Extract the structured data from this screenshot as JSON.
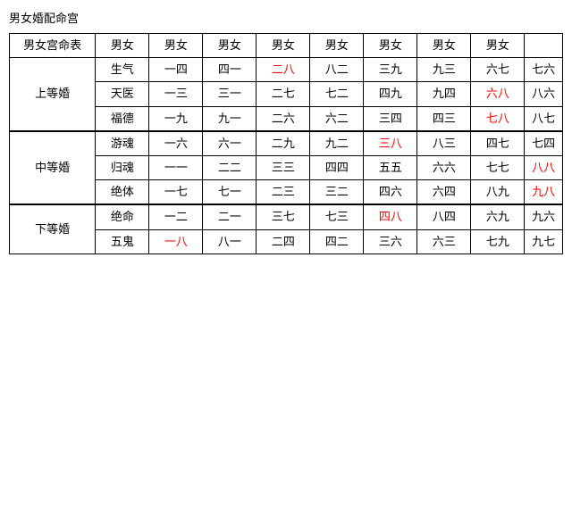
{
  "title": "男女婚配命宫",
  "table": {
    "header": {
      "col0": "男女宫命表",
      "cols": [
        "男女",
        "男女",
        "男女",
        "男女",
        "男女",
        "男女",
        "男女",
        "男女"
      ]
    },
    "sections": [
      {
        "grade": "上等婚",
        "rows": [
          {
            "category": "生气",
            "cells": [
              {
                "text": "一四",
                "red": false
              },
              {
                "text": "四一",
                "red": false
              },
              {
                "text": "二八",
                "red": true
              },
              {
                "text": "八二",
                "red": false
              },
              {
                "text": "三九",
                "red": false
              },
              {
                "text": "九三",
                "red": false
              },
              {
                "text": "六七",
                "red": false
              },
              {
                "text": "七六",
                "red": false
              }
            ]
          },
          {
            "category": "天医",
            "cells": [
              {
                "text": "一三",
                "red": false
              },
              {
                "text": "三一",
                "red": false
              },
              {
                "text": "二七",
                "red": false
              },
              {
                "text": "七二",
                "red": false
              },
              {
                "text": "四九",
                "red": false
              },
              {
                "text": "九四",
                "red": false
              },
              {
                "text": "六八",
                "red": true
              },
              {
                "text": "八六",
                "red": false
              }
            ]
          },
          {
            "category": "福德",
            "cells": [
              {
                "text": "一九",
                "red": false
              },
              {
                "text": "九一",
                "red": false
              },
              {
                "text": "二六",
                "red": false
              },
              {
                "text": "六二",
                "red": false
              },
              {
                "text": "三四",
                "red": false
              },
              {
                "text": "四三",
                "red": false
              },
              {
                "text": "七八",
                "red": true
              },
              {
                "text": "八七",
                "red": false
              }
            ]
          }
        ]
      },
      {
        "grade": "中等婚",
        "rows": [
          {
            "category": "游魂",
            "cells": [
              {
                "text": "一六",
                "red": false
              },
              {
                "text": "六一",
                "red": false
              },
              {
                "text": "二九",
                "red": false
              },
              {
                "text": "九二",
                "red": false
              },
              {
                "text": "三八",
                "red": true
              },
              {
                "text": "八三",
                "red": false
              },
              {
                "text": "四七",
                "red": false
              },
              {
                "text": "七四",
                "red": false
              }
            ]
          },
          {
            "category": "归魂",
            "cells": [
              {
                "text": "一一",
                "red": false
              },
              {
                "text": "二二",
                "red": false
              },
              {
                "text": "三三",
                "red": false
              },
              {
                "text": "四四",
                "red": false
              },
              {
                "text": "五五",
                "red": false
              },
              {
                "text": "六六",
                "red": false
              },
              {
                "text": "七七",
                "red": false
              },
              {
                "text": "八八",
                "red": true
              }
            ]
          },
          {
            "category": "绝体",
            "cells": [
              {
                "text": "一七",
                "red": false
              },
              {
                "text": "七一",
                "red": false
              },
              {
                "text": "二三",
                "red": false
              },
              {
                "text": "三二",
                "red": false
              },
              {
                "text": "四六",
                "red": false
              },
              {
                "text": "六四",
                "red": false
              },
              {
                "text": "八九",
                "red": false
              },
              {
                "text": "九八",
                "red": true
              }
            ]
          }
        ]
      },
      {
        "grade": "下等婚",
        "rows": [
          {
            "category": "绝命",
            "cells": [
              {
                "text": "一二",
                "red": false
              },
              {
                "text": "二一",
                "red": false
              },
              {
                "text": "三七",
                "red": false
              },
              {
                "text": "七三",
                "red": false
              },
              {
                "text": "四八",
                "red": true
              },
              {
                "text": "八四",
                "red": false
              },
              {
                "text": "六九",
                "red": false
              },
              {
                "text": "九六",
                "red": false
              }
            ]
          },
          {
            "category": "五鬼",
            "cells": [
              {
                "text": "一八",
                "red": true
              },
              {
                "text": "八一",
                "red": false
              },
              {
                "text": "二四",
                "red": false
              },
              {
                "text": "四二",
                "red": false
              },
              {
                "text": "三六",
                "red": false
              },
              {
                "text": "六三",
                "red": false
              },
              {
                "text": "七九",
                "red": false
              },
              {
                "text": "九七",
                "red": false
              }
            ]
          }
        ]
      }
    ]
  }
}
